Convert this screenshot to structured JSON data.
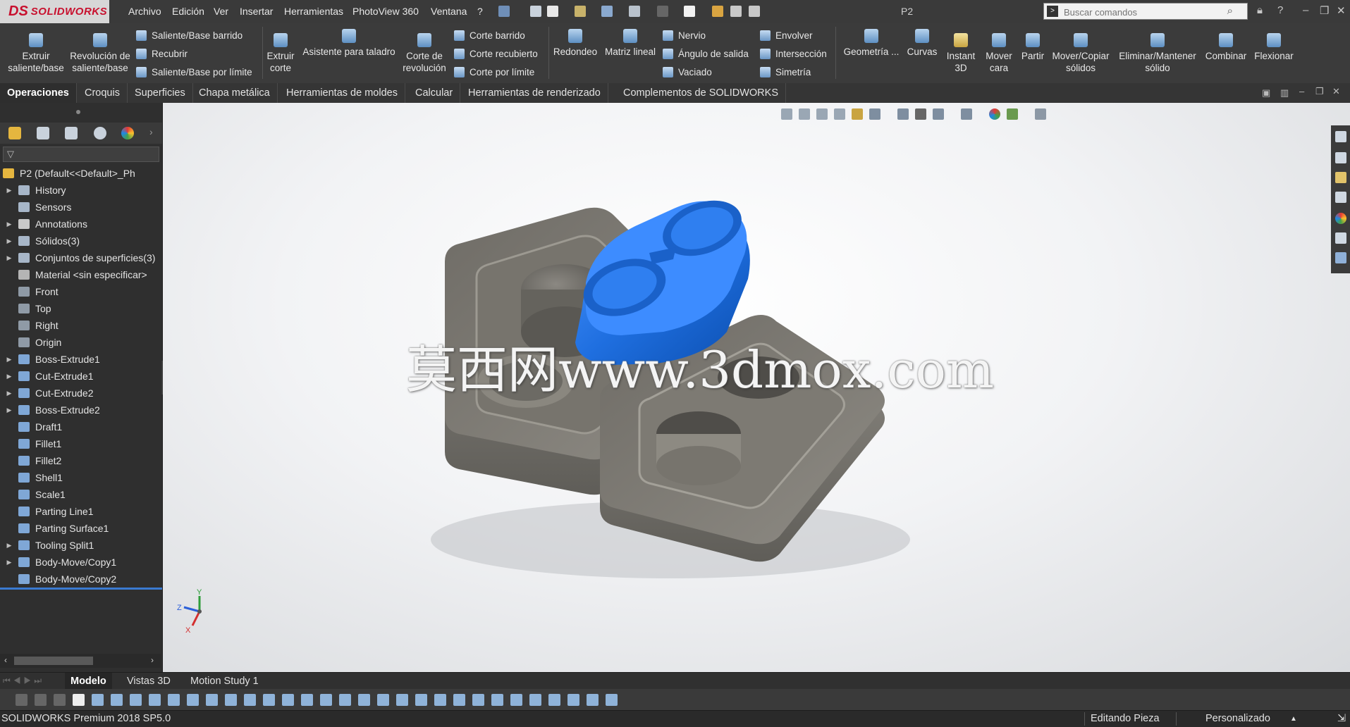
{
  "app": {
    "logo_ds": "DS",
    "logo_text": "SOLIDWORKS",
    "doc_title": "P2"
  },
  "menu": [
    "Archivo",
    "Edición",
    "Ver",
    "Insertar",
    "Herramientas",
    "PhotoView 360",
    "Ventana",
    "?"
  ],
  "search": {
    "placeholder": "Buscar comandos"
  },
  "ribbon": {
    "extruir": [
      "Extruir",
      "saliente/base"
    ],
    "revolucion": [
      "Revolución de",
      "saliente/base"
    ],
    "col1": [
      "Saliente/Base barrido",
      "Recubrir",
      "Saliente/Base por límite"
    ],
    "extruir_corte": [
      "Extruir",
      "corte"
    ],
    "asistente": "Asistente para taladro",
    "corte_revolucion": [
      "Corte de",
      "revolución"
    ],
    "col2": [
      "Corte barrido",
      "Corte recubierto",
      "Corte por límite"
    ],
    "redondeo": "Redondeo",
    "matriz": "Matriz lineal",
    "col3": [
      "Nervio",
      "Ángulo de salida",
      "Vaciado"
    ],
    "col4": [
      "Envolver",
      "Intersección",
      "Simetría"
    ],
    "geometria": "Geometría ...",
    "curvas": "Curvas",
    "instant3d": [
      "Instant",
      "3D"
    ],
    "mover_cara": [
      "Mover",
      "cara"
    ],
    "partir": "Partir",
    "mover_copiar": [
      "Mover/Copiar",
      "sólidos"
    ],
    "eliminar": [
      "Eliminar/Mantener",
      "sólido"
    ],
    "combinar": "Combinar",
    "flexionar": "Flexionar"
  },
  "tabs": [
    "Operaciones",
    "Croquis",
    "Superficies",
    "Chapa metálica",
    "Herramientas de moldes",
    "Calcular",
    "Herramientas de renderizado",
    "Complementos de SOLIDWORKS"
  ],
  "tree": {
    "root": "P2  (Default<<Default>_Ph",
    "items": [
      {
        "label": "History",
        "arrow": true,
        "color": "#a7b6c8"
      },
      {
        "label": "Sensors",
        "arrow": false,
        "color": "#a7b6c8"
      },
      {
        "label": "Annotations",
        "arrow": true,
        "color": "#c9c9c9"
      },
      {
        "label": "Sólidos(3)",
        "arrow": true,
        "color": "#a7b6c8"
      },
      {
        "label": "Conjuntos de superficies(3)",
        "arrow": true,
        "color": "#a7b6c8"
      },
      {
        "label": "Material <sin especificar>",
        "arrow": false,
        "color": "#b5b5b5"
      },
      {
        "label": "Front",
        "arrow": false,
        "color": "#8f9aa6"
      },
      {
        "label": "Top",
        "arrow": false,
        "color": "#8f9aa6"
      },
      {
        "label": "Right",
        "arrow": false,
        "color": "#8f9aa6"
      },
      {
        "label": "Origin",
        "arrow": false,
        "color": "#8f9aa6"
      },
      {
        "label": "Boss-Extrude1",
        "arrow": true,
        "color": "#7fa7d6"
      },
      {
        "label": "Cut-Extrude1",
        "arrow": true,
        "color": "#7fa7d6"
      },
      {
        "label": "Cut-Extrude2",
        "arrow": true,
        "color": "#7fa7d6"
      },
      {
        "label": "Boss-Extrude2",
        "arrow": true,
        "color": "#7fa7d6"
      },
      {
        "label": "Draft1",
        "arrow": false,
        "color": "#7fa7d6"
      },
      {
        "label": "Fillet1",
        "arrow": false,
        "color": "#7fa7d6"
      },
      {
        "label": "Fillet2",
        "arrow": false,
        "color": "#7fa7d6"
      },
      {
        "label": "Shell1",
        "arrow": false,
        "color": "#7fa7d6"
      },
      {
        "label": "Scale1",
        "arrow": false,
        "color": "#7fa7d6"
      },
      {
        "label": "Parting Line1",
        "arrow": false,
        "color": "#7fa7d6"
      },
      {
        "label": "Parting Surface1",
        "arrow": false,
        "color": "#7fa7d6"
      },
      {
        "label": "Tooling Split1",
        "arrow": true,
        "color": "#7fa7d6"
      },
      {
        "label": "Body-Move/Copy1",
        "arrow": true,
        "color": "#7fa7d6"
      },
      {
        "label": "Body-Move/Copy2",
        "arrow": false,
        "color": "#7fa7d6"
      }
    ]
  },
  "viewport": {
    "watermark": "莫西网www.3dmox.com",
    "axis_x": "X",
    "axis_y": "Y",
    "axis_z": "Z"
  },
  "bottom_tabs": [
    "Modelo",
    "Vistas 3D",
    "Motion Study 1"
  ],
  "status": {
    "product": "SOLIDWORKS Premium 2018 SP5.0",
    "mode": "Editando Pieza",
    "custom": "Personalizado"
  },
  "colors": {
    "accent": "#3a7ad1",
    "blue_part": "#1f6fe0",
    "gray_part": "#7a7770",
    "brand_red": "#c8102e"
  }
}
